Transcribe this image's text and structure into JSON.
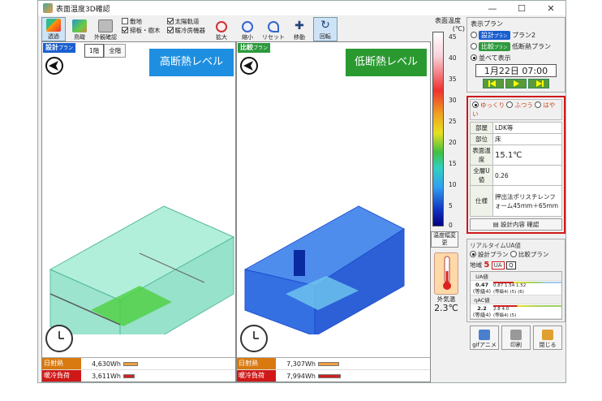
{
  "window": {
    "title": "表面温度3D確認",
    "controls": [
      "—",
      "☐",
      "✕"
    ]
  },
  "toolbar": {
    "buttons": [
      {
        "label": "透過",
        "icon": "transparent-icon",
        "active": true
      },
      {
        "label": "鳥瞰",
        "icon": "birdseye-icon",
        "active": false
      },
      {
        "label": "外観確認",
        "icon": "exterior-icon",
        "active": false
      }
    ],
    "checks_col1": [
      {
        "label": "敷地",
        "checked": false
      },
      {
        "label": "掃板・樹木",
        "checked": true
      }
    ],
    "checks_col2": [
      {
        "label": "太陽軌道",
        "checked": true
      },
      {
        "label": "暖冷房機器",
        "checked": true
      }
    ],
    "view_buttons": [
      {
        "label": "拡大",
        "icon": "zoom-in-icon"
      },
      {
        "label": "縮小",
        "icon": "zoom-out-icon"
      },
      {
        "label": "リセット",
        "icon": "reset-icon"
      },
      {
        "label": "移動",
        "icon": "move-icon"
      },
      {
        "label": "回転",
        "icon": "rotate-icon",
        "active": true
      }
    ]
  },
  "left_pane": {
    "plan_tag": "設計",
    "plan_tag_sub": "プラン",
    "banner": "高断熱レベル",
    "floor_buttons": [
      "1階",
      "全階"
    ],
    "stats": [
      {
        "label": "日射熱",
        "value": "4,630Wh",
        "bar": 0.22,
        "label_color": "#d87a10",
        "bar_color": "#f0a040"
      },
      {
        "label": "暖冷負荷",
        "value": "3,611Wh",
        "bar": 0.17,
        "label_color": "#d01818",
        "bar_color": "#d02020"
      }
    ]
  },
  "right_pane": {
    "plan_tag": "比較",
    "plan_tag_sub": "プラン",
    "banner": "低断熱レベル",
    "stats": [
      {
        "label": "日射熱",
        "value": "7,307Wh",
        "bar": 0.35,
        "label_color": "#d87a10",
        "bar_color": "#f0a040"
      },
      {
        "label": "暖冷負荷",
        "value": "7,994Wh",
        "bar": 0.38,
        "label_color": "#d01818",
        "bar_color": "#d02020"
      }
    ]
  },
  "scale": {
    "title": "表面温度",
    "unit": "(℃)",
    "ticks": [
      "45",
      "40",
      "35",
      "30",
      "25",
      "20",
      "15",
      "10",
      "5",
      "0"
    ],
    "change_button": "温度幅変更",
    "outdoor_label": "外気温",
    "outdoor_value": "2.3℃"
  },
  "side": {
    "display_plan_title": "表示プラン",
    "plan_options": [
      {
        "pill": "設計",
        "pill_sub": "プラン",
        "pill_color": "#1a5fd0",
        "text": "プラン2",
        "selected": false
      },
      {
        "pill": "比較",
        "pill_sub": "プラン",
        "pill_color": "#2c9a3c",
        "text": "低断熱プラン",
        "selected": false
      },
      {
        "pill": "",
        "pill_sub": "",
        "pill_color": "",
        "text": "並べて表示",
        "selected": true
      }
    ],
    "date": "1月22日 07:00",
    "speed_options": [
      {
        "label": "ゆっくり",
        "selected": true
      },
      {
        "label": "ふつう",
        "selected": false
      },
      {
        "label": "はやい",
        "selected": false
      }
    ],
    "info": [
      {
        "key": "部屋",
        "value": "LDK等"
      },
      {
        "key": "部位",
        "value": "床"
      },
      {
        "key": "表面温度",
        "value": "15.1℃"
      },
      {
        "key": "全層U値",
        "value": "0.26"
      },
      {
        "key": "仕様",
        "value": "押出法ポリスチレンフォーム45mm＋65mm"
      }
    ],
    "detail_button": "設計内容 確認",
    "realtime_title": "リアルタイムUA値",
    "realtime_options": [
      {
        "label": "設計プラン",
        "selected": true
      },
      {
        "label": "比較プラン",
        "selected": false
      }
    ],
    "region_label": "地域",
    "region_value": "5",
    "ua_buttons": [
      "UA",
      "Q"
    ],
    "ua_rows": [
      {
        "title": "UA値",
        "value": "0.47",
        "grade": "(等級4)",
        "scale": "0.87  1.54 1.52",
        "scale_grade": "(等級4)  (5)  (6)"
      },
      {
        "title": "ηAC値",
        "value": "2.2",
        "grade": "(等級4)",
        "scale": "2.8   4.0",
        "scale_grade": "(等級4)  (5)"
      }
    ],
    "bottom_buttons": [
      {
        "label": "gifアニメ",
        "icon": "gif-anim-icon"
      },
      {
        "label": "印刷",
        "icon": "print-icon"
      },
      {
        "label": "閉じる",
        "icon": "exit-icon"
      }
    ]
  }
}
